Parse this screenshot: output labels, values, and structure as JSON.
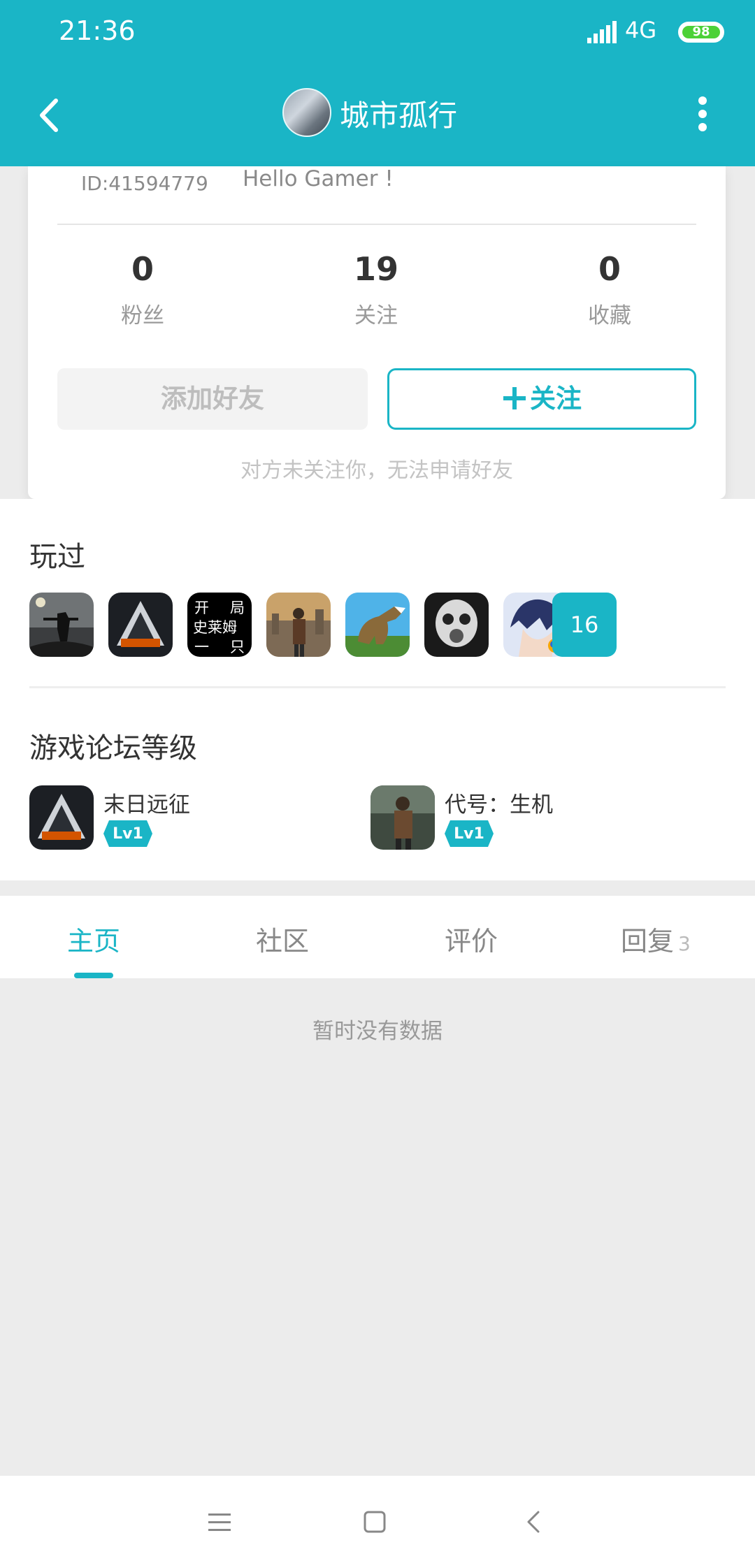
{
  "status": {
    "time": "21:36",
    "network": "4G",
    "battery": "98"
  },
  "header": {
    "title": "城市孤行"
  },
  "profile": {
    "id": "ID:41594779",
    "bio": "Hello Gamer !"
  },
  "stats": [
    {
      "num": "0",
      "label": "粉丝"
    },
    {
      "num": "19",
      "label": "关注"
    },
    {
      "num": "0",
      "label": "收藏"
    }
  ],
  "actions": {
    "add_friend": "添加好友",
    "follow": "关注",
    "hint": "对方未关注你，无法申请好友"
  },
  "played": {
    "title": "玩过",
    "more_count": "16",
    "icon_text": [
      "开",
      "局",
      "史莱姆",
      "一",
      "只"
    ]
  },
  "forum": {
    "title": "游戏论坛等级",
    "items": [
      {
        "name": "末日远征",
        "level": "Lv1"
      },
      {
        "name": "代号：生机",
        "level": "Lv1"
      }
    ]
  },
  "tabs": [
    {
      "label": "主页"
    },
    {
      "label": "社区"
    },
    {
      "label": "评价"
    },
    {
      "label": "回复",
      "count": "3"
    }
  ],
  "content": {
    "empty": "暂时没有数据"
  },
  "colors": {
    "accent": "#1ab5c6",
    "battery": "#4cd137"
  }
}
